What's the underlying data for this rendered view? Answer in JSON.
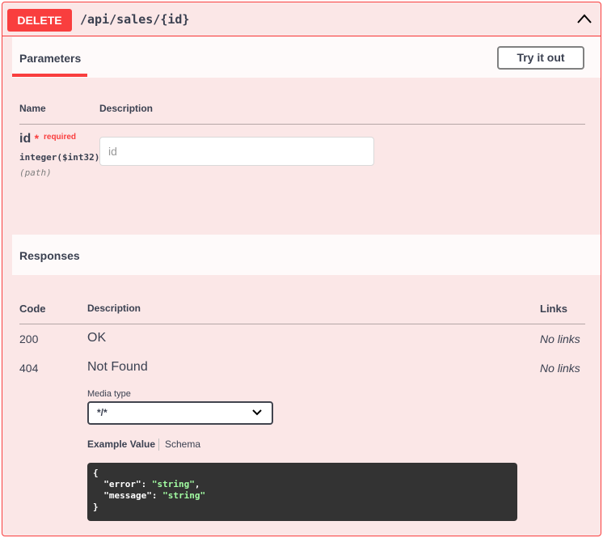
{
  "summary": {
    "method": "DELETE",
    "path": "/api/sales/{id}",
    "collapse_icon": "chevron-up-icon"
  },
  "parameters": {
    "tab_label": "Parameters",
    "try_it_out_label": "Try it out",
    "headers": {
      "name": "Name",
      "description": "Description"
    },
    "items": [
      {
        "name": "id",
        "star": "*",
        "required_label": "required",
        "type": "integer($int32)",
        "in": "(path)",
        "placeholder": "id",
        "value": ""
      }
    ]
  },
  "responses": {
    "title": "Responses",
    "headers": {
      "code": "Code",
      "description": "Description",
      "links": "Links"
    },
    "rows": [
      {
        "code": "200",
        "description": "OK",
        "links": "No links"
      },
      {
        "code": "404",
        "description": "Not Found",
        "links": "No links"
      }
    ],
    "media_type_label": "Media type",
    "media_type_value": "*/*",
    "example_tab": "Example Value",
    "schema_tab": "Schema",
    "example": {
      "open": "{",
      "line1_key": "\"error\"",
      "line1_val": "\"string\"",
      "line2_key": "\"message\"",
      "line2_val": "\"string\"",
      "close": "}"
    }
  },
  "colors": {
    "accent": "#f93e3e",
    "background": "#fbe7e7",
    "code_bg": "#333333"
  }
}
